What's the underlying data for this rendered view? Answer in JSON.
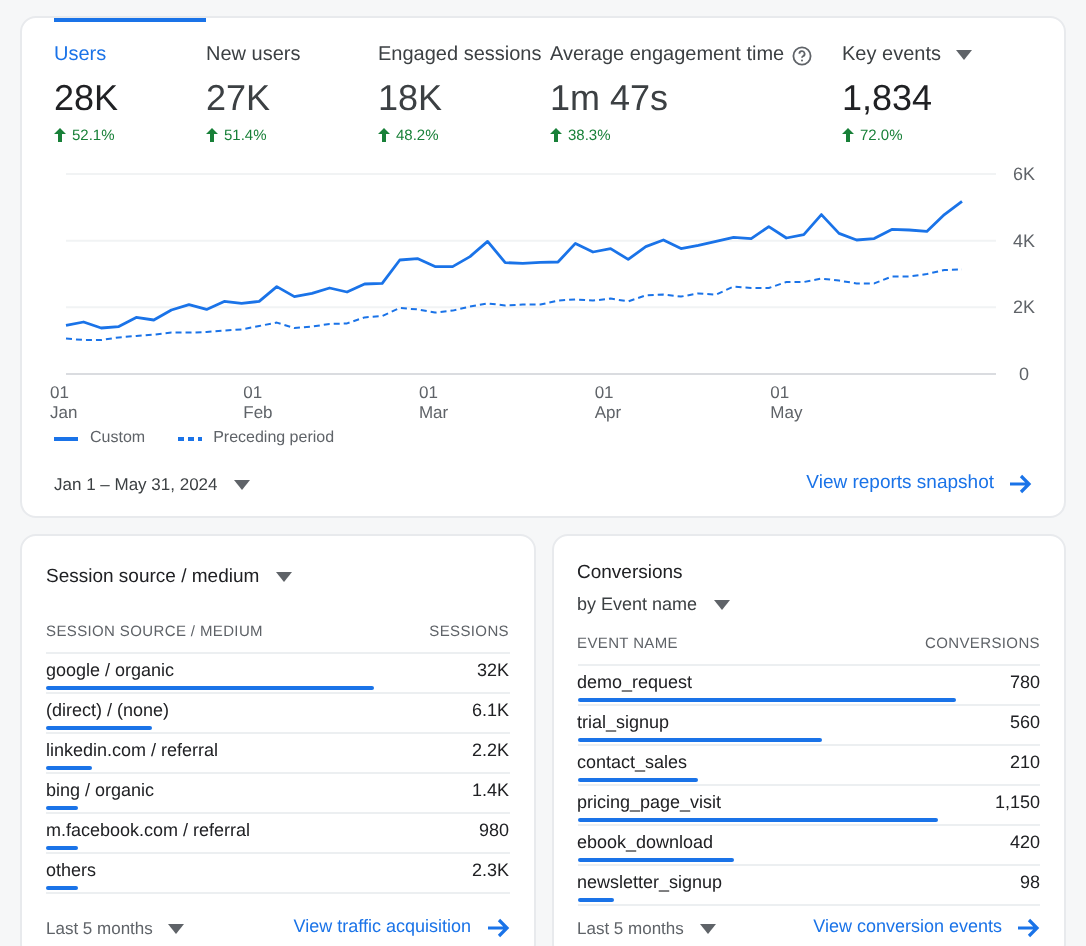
{
  "metrics": [
    {
      "label": "Users",
      "value": "28K",
      "change": "52.1%",
      "selected": true,
      "kind": "plain"
    },
    {
      "label": "New users",
      "value": "27K",
      "change": "51.4%",
      "selected": false,
      "kind": "plain"
    },
    {
      "label": "Engaged sessions",
      "value": "18K",
      "change": "48.2%",
      "selected": false,
      "kind": "plain"
    },
    {
      "label": "Average engagement time",
      "value": "1m 47s",
      "change": "38.3%",
      "selected": false,
      "kind": "help"
    },
    {
      "label": "Key events",
      "value": "1,834",
      "change": "72.0%",
      "selected": false,
      "kind": "menu"
    }
  ],
  "chart_data": {
    "type": "line",
    "categories": [
      "01 Jan",
      null,
      null,
      null,
      null,
      null,
      null,
      null,
      null,
      null,
      null,
      "01 Feb",
      null,
      null,
      null,
      null,
      null,
      null,
      null,
      null,
      null,
      "01 Mar",
      null,
      null,
      null,
      null,
      null,
      null,
      null,
      null,
      null,
      "01 Apr",
      null,
      null,
      null,
      null,
      null,
      null,
      null,
      null,
      null,
      "01 May",
      null,
      null,
      null,
      null,
      null,
      null,
      null,
      null,
      null,
      null
    ],
    "series": [
      {
        "name": "Custom",
        "color": "#1a73e8",
        "line_style": "solid",
        "values": [
          1460,
          1560,
          1380,
          1420,
          1700,
          1620,
          1920,
          2080,
          1940,
          2180,
          2120,
          2180,
          2620,
          2320,
          2420,
          2580,
          2460,
          2700,
          2720,
          3420,
          3460,
          3220,
          3220,
          3520,
          3980,
          3340,
          3320,
          3350,
          3360,
          3920,
          3660,
          3760,
          3440,
          3820,
          4020,
          3760,
          3860,
          3980,
          4100,
          4060,
          4420,
          4080,
          4180,
          4780,
          4220,
          4020,
          4060,
          4340,
          4320,
          4280,
          4780,
          5180
        ]
      },
      {
        "name": "Preceding period",
        "color": "#1a73e8",
        "line_style": "dashed",
        "values": [
          1060,
          1020,
          1020,
          1100,
          1140,
          1180,
          1240,
          1240,
          1260,
          1300,
          1340,
          1440,
          1540,
          1380,
          1420,
          1500,
          1520,
          1700,
          1740,
          1980,
          1940,
          1840,
          1900,
          2020,
          2120,
          2060,
          2080,
          2080,
          2200,
          2240,
          2200,
          2260,
          2180,
          2360,
          2380,
          2320,
          2420,
          2380,
          2620,
          2580,
          2580,
          2760,
          2760,
          2860,
          2800,
          2720,
          2720,
          2920,
          2920,
          3000,
          3120,
          3140
        ]
      }
    ],
    "ylim": [
      0,
      6000
    ],
    "yticks": [
      {
        "value": 0,
        "label": "0"
      },
      {
        "value": 2000,
        "label": "2K"
      },
      {
        "value": 4000,
        "label": "4K"
      },
      {
        "value": 6000,
        "label": "6K"
      }
    ]
  },
  "date_range": "Jan 1 – May 31, 2024",
  "overview_link": "View reports snapshot",
  "cards": [
    {
      "title": "Session source / medium",
      "columns": [
        "SESSION SOURCE / MEDIUM",
        "SESSIONS"
      ],
      "rows": [
        {
          "name": "google / organic",
          "value": "32K",
          "level": 0.71
        },
        {
          "name": "(direct) / (none)",
          "value": "6.1K",
          "level": 0.23
        },
        {
          "name": "linkedin.com / referral",
          "value": "2.2K",
          "level": 0.1
        },
        {
          "name": "bing / organic",
          "value": "1.4K",
          "level": 0.07
        },
        {
          "name": "m.facebook.com / referral",
          "value": "980",
          "level": 0.07
        },
        {
          "name": "others",
          "value": "2.3K",
          "level": 0.07
        }
      ],
      "period": "Last 5 months",
      "link": "View traffic acquisition"
    },
    {
      "title": "Conversions",
      "subtitle": "by Event name",
      "columns": [
        "EVENT NAME",
        "CONVERSIONS"
      ],
      "rows": [
        {
          "name": "demo_request",
          "value": "780",
          "level": 0.82
        },
        {
          "name": "trial_signup",
          "value": "560",
          "level": 0.53
        },
        {
          "name": "contact_sales",
          "value": "210",
          "level": 0.26
        },
        {
          "name": "pricing_page_visit",
          "value": "1,150",
          "level": 0.78
        },
        {
          "name": "ebook_download",
          "value": "420",
          "level": 0.34
        },
        {
          "name": "newsletter_signup",
          "value": "98",
          "level": 0.08
        }
      ],
      "period": "Last 5 months",
      "link": "View conversion events"
    }
  ]
}
